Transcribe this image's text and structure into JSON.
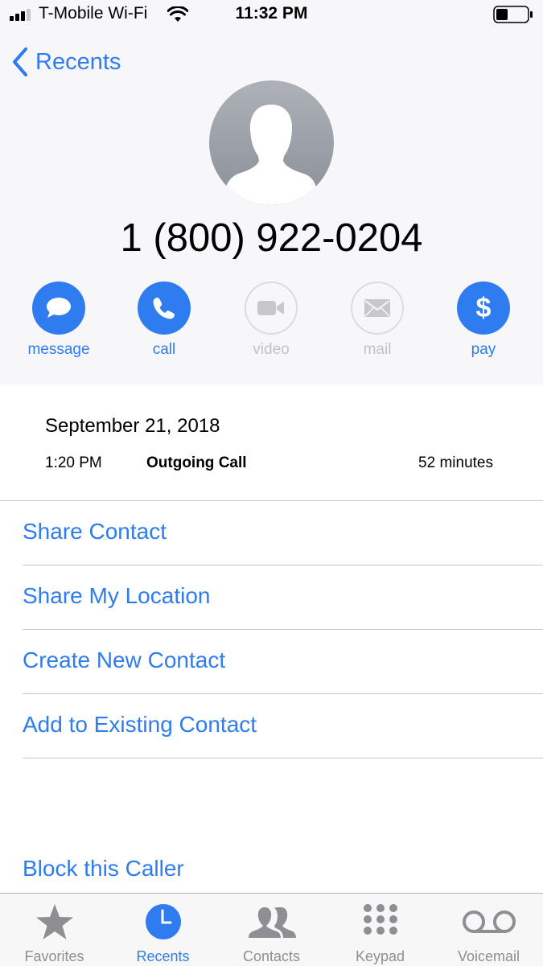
{
  "status_bar": {
    "carrier": "T-Mobile Wi-Fi",
    "time": "11:32 PM"
  },
  "nav": {
    "back_label": "Recents"
  },
  "contact": {
    "phone_number": "1 (800) 922-0204"
  },
  "actions": [
    {
      "label": "message",
      "icon": "message-icon",
      "enabled": true
    },
    {
      "label": "call",
      "icon": "phone-icon",
      "enabled": true
    },
    {
      "label": "video",
      "icon": "video-icon",
      "enabled": false
    },
    {
      "label": "mail",
      "icon": "mail-icon",
      "enabled": false
    },
    {
      "label": "pay",
      "icon": "dollar-icon",
      "enabled": true
    }
  ],
  "call_log": {
    "date": "September 21, 2018",
    "time": "1:20 PM",
    "type": "Outgoing Call",
    "duration": "52 minutes"
  },
  "options": [
    "Share Contact",
    "Share My Location",
    "Create New Contact",
    "Add to Existing Contact"
  ],
  "block_label": "Block this Caller",
  "tab_bar": {
    "tabs": [
      {
        "label": "Favorites",
        "icon": "star-icon"
      },
      {
        "label": "Recents",
        "icon": "clock-icon"
      },
      {
        "label": "Contacts",
        "icon": "contacts-icon"
      },
      {
        "label": "Keypad",
        "icon": "keypad-icon"
      },
      {
        "label": "Voicemail",
        "icon": "voicemail-icon"
      }
    ],
    "active": "Recents"
  },
  "colors": {
    "accent": "#2f7cf0",
    "disabled": "#c2c2c7",
    "header_bg": "#f7f7f9"
  }
}
